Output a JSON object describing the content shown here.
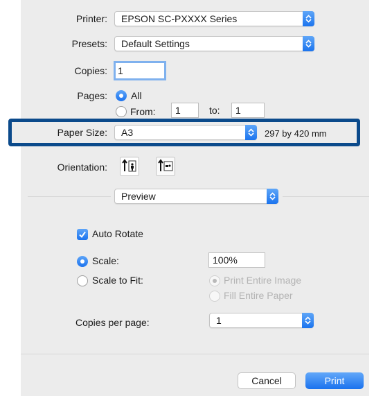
{
  "printer": {
    "label": "Printer:",
    "value": "EPSON SC-PXXXX Series"
  },
  "presets": {
    "label": "Presets:",
    "value": "Default Settings"
  },
  "copies": {
    "label": "Copies:",
    "value": "1"
  },
  "pages": {
    "label": "Pages:",
    "all_label": "All",
    "from_label": "From:",
    "from_value": "1",
    "to_label": "to:",
    "to_value": "1"
  },
  "paper_size": {
    "label": "Paper Size:",
    "value": "A3",
    "dimensions": "297 by 420 mm"
  },
  "orientation": {
    "label": "Orientation:",
    "options": [
      "portrait-icon",
      "landscape-icon"
    ],
    "selected": "portrait"
  },
  "section_popup": {
    "value": "Preview"
  },
  "auto_rotate": {
    "label": "Auto Rotate",
    "checked": true
  },
  "scale": {
    "label": "Scale:",
    "value": "100%",
    "selected": true
  },
  "scale_to_fit": {
    "label": "Scale to Fit:",
    "print_entire_image": "Print Entire Image",
    "fill_entire_paper": "Fill Entire Paper"
  },
  "copies_per_page": {
    "label": "Copies per page:",
    "value": "1"
  },
  "buttons": {
    "cancel": "Cancel",
    "print": "Print"
  },
  "colors": {
    "accent": "#1c73ee",
    "highlight_border": "#0b4a8b",
    "dialog_bg": "#ececec"
  }
}
